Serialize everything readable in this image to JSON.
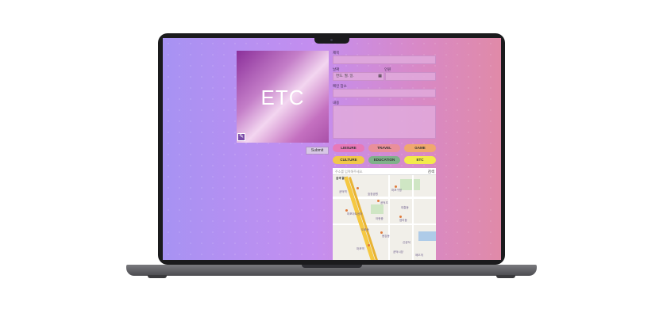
{
  "form": {
    "title_label": "제목",
    "date_label": "날짜",
    "date_value": "연도. 월. 일.",
    "amount_label": "인원",
    "place_label": "메인 장소",
    "content_label": "내용"
  },
  "cover": {
    "text": "ETC"
  },
  "submit_label": "Submit",
  "categories": [
    "LEISURE",
    "TRAVEL",
    "GAME",
    "CULTURE",
    "EDUCATION",
    "ETC"
  ],
  "map": {
    "search_placeholder": "주소를 입력해주세요.",
    "search_button": "검색",
    "result_label": "검색 결과",
    "pois": [
      "공덕역",
      "마포구청",
      "효창공원",
      "공덕초",
      "대흥동",
      "마포아트센터",
      "아현중",
      "염리동",
      "도화동",
      "용강동",
      "신공덕",
      "마포역",
      "공덕시장",
      "애오개"
    ]
  },
  "colors": {
    "screen_gradient_start": "#a792f3",
    "screen_gradient_end": "#e08aa8",
    "leisure": "#e879b8",
    "travel": "#e98f9a",
    "game": "#f0a86d",
    "culture": "#f1c74a",
    "education": "#7fb08a",
    "etc": "#f3ea4a"
  }
}
